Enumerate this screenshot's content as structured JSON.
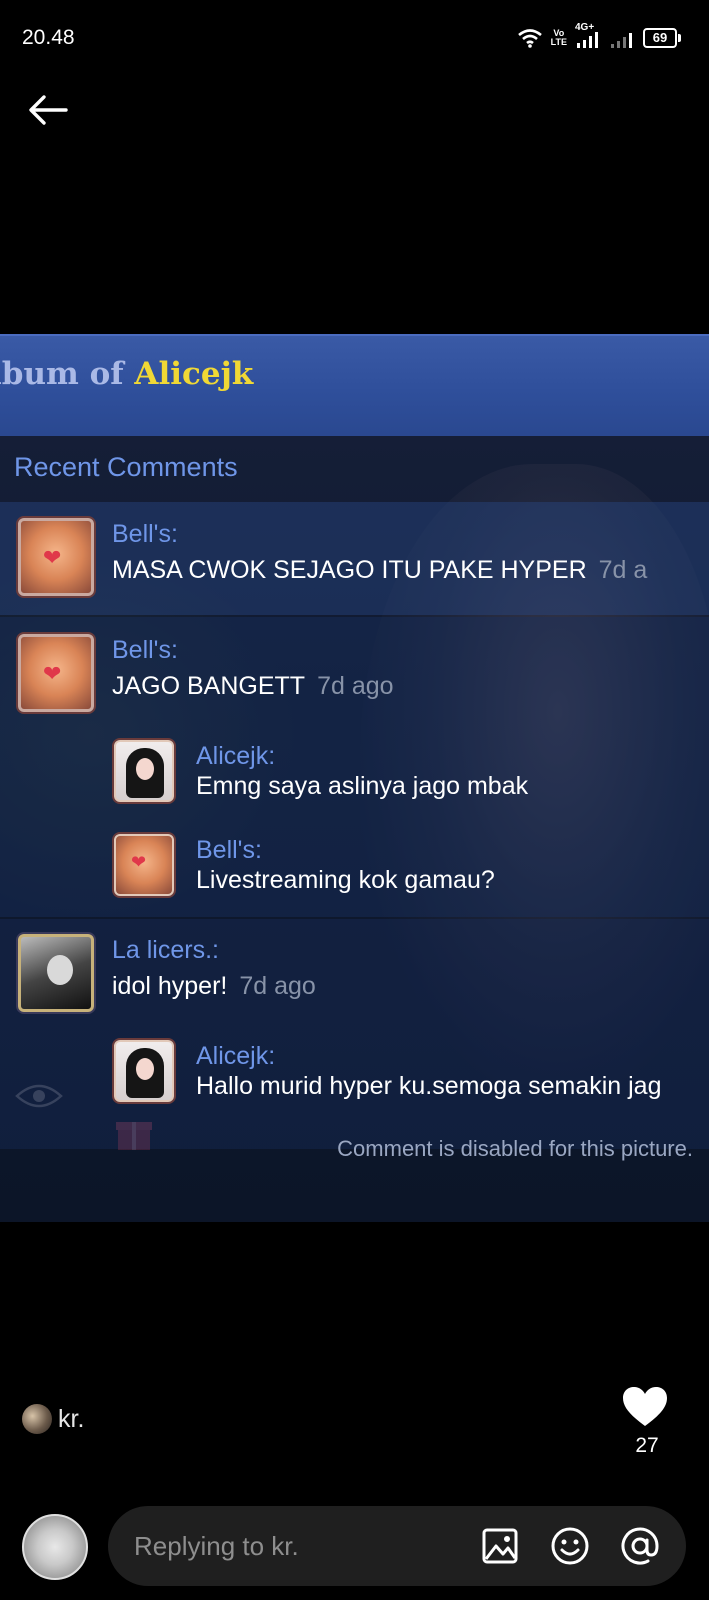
{
  "status_bar": {
    "time": "20.48",
    "volte_line1": "Vo",
    "volte_line2": "LTE",
    "network": "4G+",
    "battery": "69"
  },
  "album": {
    "title_prefix": "lbum of ",
    "owner": "Alicejk"
  },
  "recent_comments_heading": "Recent Comments",
  "comments": [
    {
      "author": "Bell's:",
      "text": "MASA CWOK SEJAGO ITU PAKE HYPER",
      "time": "7d a"
    },
    {
      "author": "Bell's:",
      "text": "JAGO BANGETT",
      "time": "7d ago"
    },
    {
      "author": "Alicejk:",
      "text": "Emng saya aslinya jago mbak"
    },
    {
      "author": "Bell's:",
      "text": "Livestreaming kok gamau?"
    },
    {
      "author": "La licers.:",
      "text": "idol hyper!",
      "time": "7d ago"
    },
    {
      "author": "Alicejk:",
      "text": "Hallo murid hyper ku.semoga semakin jag"
    }
  ],
  "disabled_note": "Comment is disabled for this picture.",
  "poster": {
    "name": "kr."
  },
  "like_count": "27",
  "reply": {
    "placeholder": "Replying to kr."
  },
  "colors": {
    "album_owner": "#f0d835",
    "author_name": "#6f96e8",
    "header_blue": "#2f4f9b"
  },
  "icons": [
    "back-arrow-icon",
    "wifi-icon",
    "signal-icon",
    "heart-icon",
    "image-icon",
    "emoji-icon",
    "at-icon"
  ]
}
